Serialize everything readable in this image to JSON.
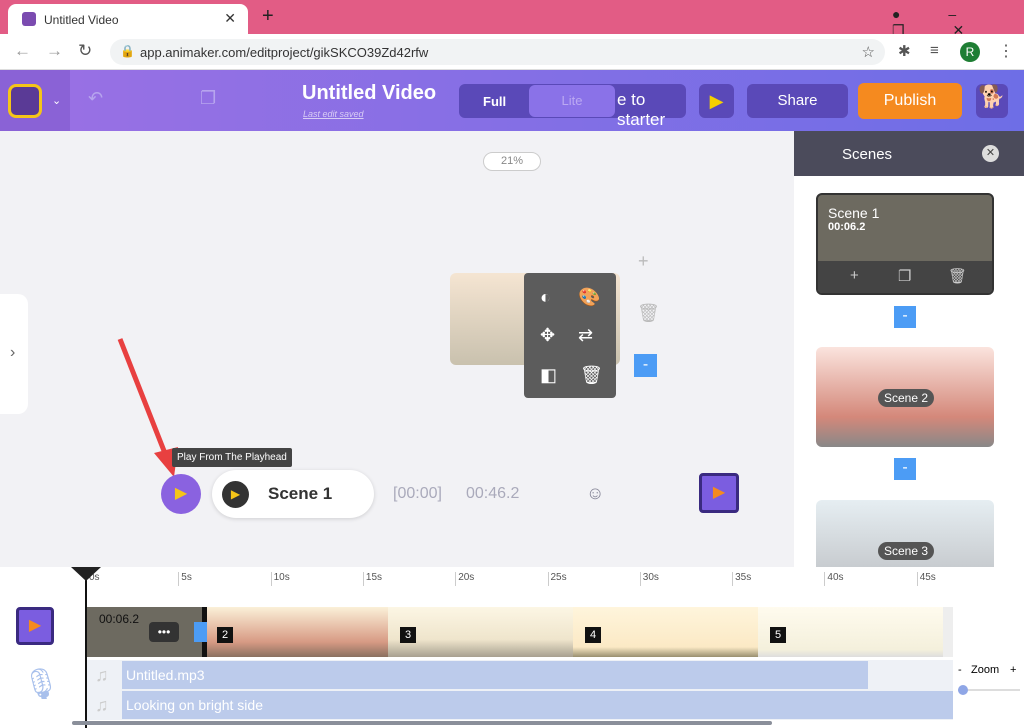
{
  "browser": {
    "tab_title": "Untitled Video",
    "url": "app.animaker.com/editproject/gikSKCO39Zd42rfw",
    "profile_initial": "R"
  },
  "header": {
    "title": "Untitled Video",
    "subtitle": "Last edit saved",
    "mode_full": "Full",
    "mode_lite": "Lite",
    "starter_label": "e to starter",
    "share": "Share",
    "publish": "Publish"
  },
  "canvas": {
    "zoom": "21%",
    "tooltip": "Play From The Playhead",
    "scene_name": "Scene 1",
    "time_current": "[00:00]",
    "time_total": "00:46.2"
  },
  "scenes_panel": {
    "title": "Scenes",
    "items": [
      {
        "label": "Scene 1",
        "duration": "00:06.2"
      },
      {
        "label": "Scene 2"
      },
      {
        "label": "Scene 3"
      }
    ]
  },
  "timeline": {
    "ticks": [
      "0s",
      "5s",
      "10s",
      "15s",
      "20s",
      "25s",
      "30s",
      "35s",
      "40s",
      "45s"
    ],
    "clip_duration": "00:06.2",
    "scene_numbers": [
      "2",
      "3",
      "4",
      "5"
    ],
    "audio": [
      "Untitled.mp3",
      "Looking on bright side"
    ],
    "zoom_label": "Zoom",
    "zoom_minus": "-",
    "zoom_plus": "+",
    "zoom_level": 0
  },
  "colors": {
    "accent": "#7b6ee6",
    "publish": "#f58a1f",
    "tab_bar": "#e25c85"
  }
}
